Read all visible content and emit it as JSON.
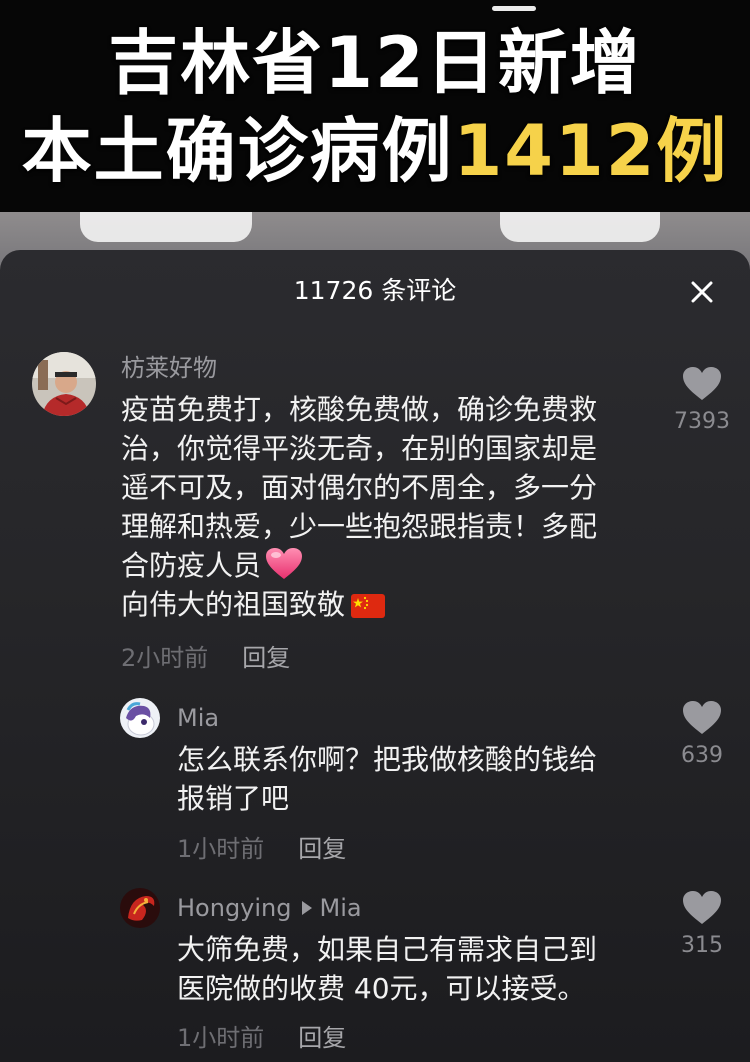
{
  "video": {
    "headline_line1": "吉林省12日新增",
    "headline_line2_main": "本土确诊病例",
    "headline_line2_highlight": "1412例"
  },
  "comments_panel": {
    "title": "11726 条评论",
    "close_icon": "close-icon"
  },
  "comments": [
    {
      "user": "枋莱好物",
      "text_lines": [
        "疫苗免费打，核酸免费做，确诊免费救",
        "治，你觉得平淡无奇，在别的国家却是",
        "遥不可及，面对偶尔的不周全，多一分",
        "理解和热爱，少一些抱怨跟指责！多配",
        "合防疫人员",
        "向伟大的祖国致敬"
      ],
      "time": "2小时前",
      "reply_label": "回复",
      "likes": "7393"
    },
    {
      "user": "Mia",
      "text_lines": [
        "怎么联系你啊？把我做核酸的钱给",
        "报销了吧"
      ],
      "time": "1小时前",
      "reply_label": "回复",
      "likes": "639"
    },
    {
      "user": "Hongying",
      "reply_to": "Mia",
      "text_lines": [
        "大筛免费，如果自己有需求自己到",
        "医院做的收费 40元，可以接受。"
      ],
      "time": "1小时前",
      "reply_label": "回复",
      "likes": "315"
    }
  ],
  "colors": {
    "highlight": "#f6d24a",
    "sheet_bg": "#262629",
    "heart_emoji": "#f0457f",
    "like_icon": "#9a9a9f"
  }
}
